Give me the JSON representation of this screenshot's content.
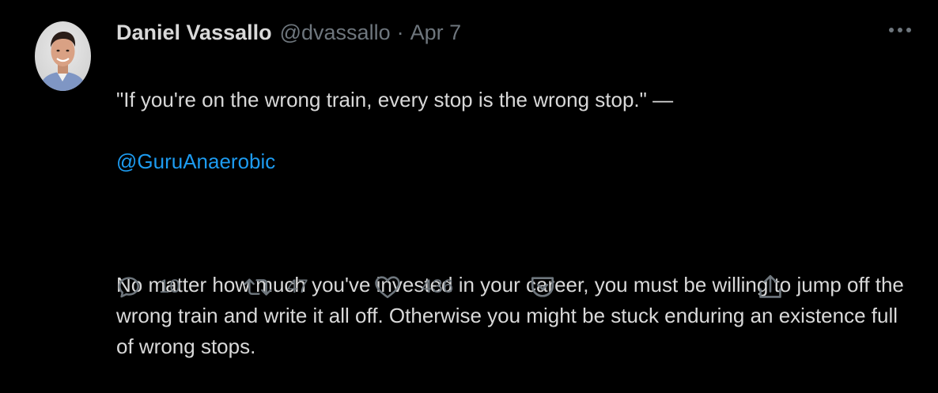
{
  "author": {
    "display_name": "Daniel Vassallo",
    "handle": "@dvassallo",
    "separator": "·",
    "date": "Apr 7"
  },
  "tweet": {
    "line1": "\"If you're on the wrong train, every stop is the wrong stop.\" —",
    "mention": "@GuruAnaerobic",
    "paragraph2": "No matter how much you've invested in your career, you must be willing to jump off the wrong train and write it all off. Otherwise you might be stuck enduring an existence full of wrong stops."
  },
  "actions": {
    "reply_count": "10",
    "retweet_count": "47",
    "like_count": "436"
  },
  "icons": {
    "more": "more-horizontal-icon",
    "reply": "reply-icon",
    "retweet": "retweet-icon",
    "like": "heart-icon",
    "save": "pocket-icon",
    "share": "share-icon"
  },
  "colors": {
    "background": "#000000",
    "text": "#d9d9d9",
    "secondary": "#6e767d",
    "link": "#1d9bf0"
  }
}
